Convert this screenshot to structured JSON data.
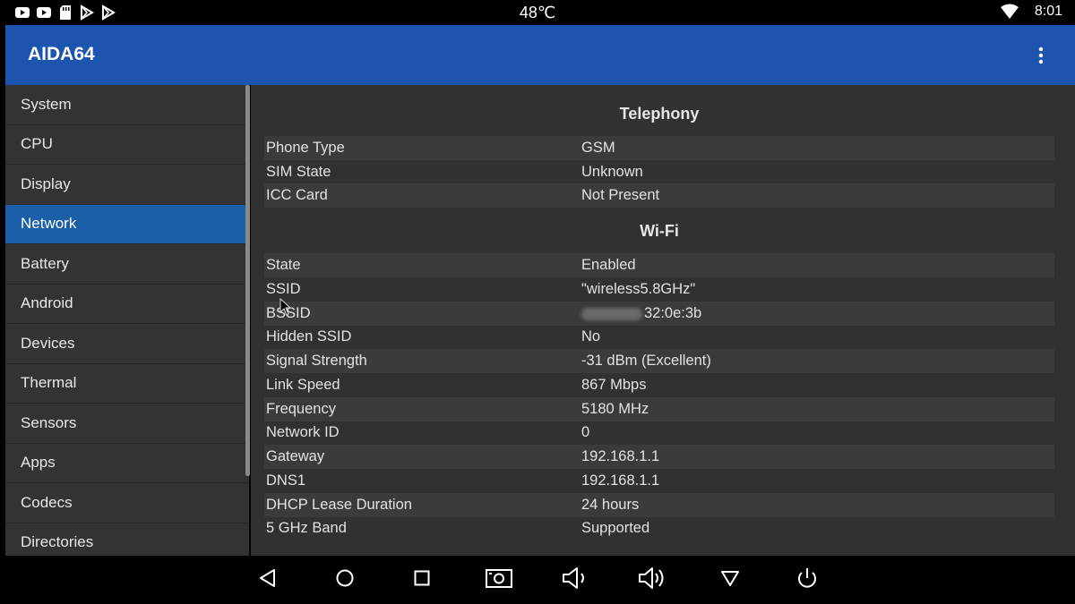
{
  "status_bar": {
    "temperature": "48℃",
    "time": "8:01",
    "notification_icons": [
      "youtube-icon",
      "youtube-icon",
      "sd-card-icon",
      "play-store-icon",
      "play-store-icon"
    ],
    "wifi_icon": "wifi-icon"
  },
  "app": {
    "title": "AIDA64",
    "menu_icon": "overflow-menu-icon",
    "accent_color": "#1c54b0"
  },
  "sidebar": {
    "items": [
      {
        "label": "System"
      },
      {
        "label": "CPU"
      },
      {
        "label": "Display"
      },
      {
        "label": "Network",
        "active": true
      },
      {
        "label": "Battery"
      },
      {
        "label": "Android"
      },
      {
        "label": "Devices"
      },
      {
        "label": "Thermal"
      },
      {
        "label": "Sensors"
      },
      {
        "label": "Apps"
      },
      {
        "label": "Codecs"
      },
      {
        "label": "Directories"
      }
    ],
    "selected_color": "#1b5fa8"
  },
  "telephony": {
    "title": "Telephony",
    "rows": [
      {
        "key": "Phone Type",
        "value": "GSM"
      },
      {
        "key": "SIM State",
        "value": "Unknown"
      },
      {
        "key": "ICC Card",
        "value": "Not Present"
      }
    ]
  },
  "wifi": {
    "title": "Wi-Fi",
    "rows": [
      {
        "key": "State",
        "value": "Enabled"
      },
      {
        "key": "SSID",
        "value": "\"wireless5.8GHz\""
      },
      {
        "key": "BSSID",
        "value": "32:0e:3b"
      },
      {
        "key": "Hidden SSID",
        "value": "No"
      },
      {
        "key": "Signal Strength",
        "value": "-31 dBm (Excellent)"
      },
      {
        "key": "Link Speed",
        "value": "867 Mbps"
      },
      {
        "key": "Frequency",
        "value": "5180 MHz"
      },
      {
        "key": "Network ID",
        "value": "0"
      },
      {
        "key": "Gateway",
        "value": "192.168.1.1"
      },
      {
        "key": "DNS1",
        "value": "192.168.1.1"
      },
      {
        "key": "DHCP Lease Duration",
        "value": "24 hours"
      },
      {
        "key": "5 GHz Band",
        "value": "Supported"
      }
    ]
  },
  "nav_bar": {
    "buttons": [
      "back-icon",
      "home-icon",
      "recents-icon",
      "screenshot-icon",
      "volume-down-icon",
      "volume-up-icon",
      "menu-down-icon",
      "power-icon"
    ]
  }
}
